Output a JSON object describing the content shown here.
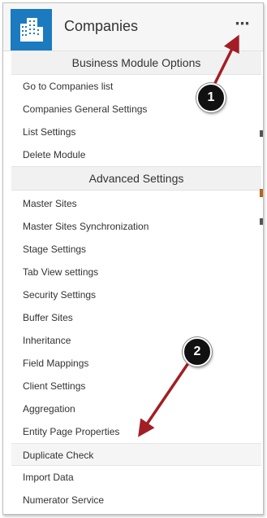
{
  "header": {
    "title": "Companies",
    "more_label": "⋯",
    "icon": "building-icon"
  },
  "sections": [
    {
      "title": "Business Module Options",
      "items": [
        "Go to Companies list",
        "Companies General Settings",
        "List Settings",
        "Delete Module"
      ]
    },
    {
      "title": "Advanced Settings",
      "items": [
        "Master Sites",
        "Master Sites Synchronization",
        "Stage Settings",
        "Tab View settings",
        "Security Settings",
        "Buffer Sites",
        "Inheritance",
        "Field Mappings",
        "Client Settings",
        "Aggregation",
        "Entity Page Properties",
        "Duplicate Check",
        "Import Data",
        "Numerator Service"
      ]
    }
  ],
  "annotations": {
    "marker_1": "1",
    "marker_2": "2",
    "arrow_color": "#a31d24"
  },
  "colors": {
    "accent": "#1c7abf",
    "marker_bg": "#111111"
  }
}
